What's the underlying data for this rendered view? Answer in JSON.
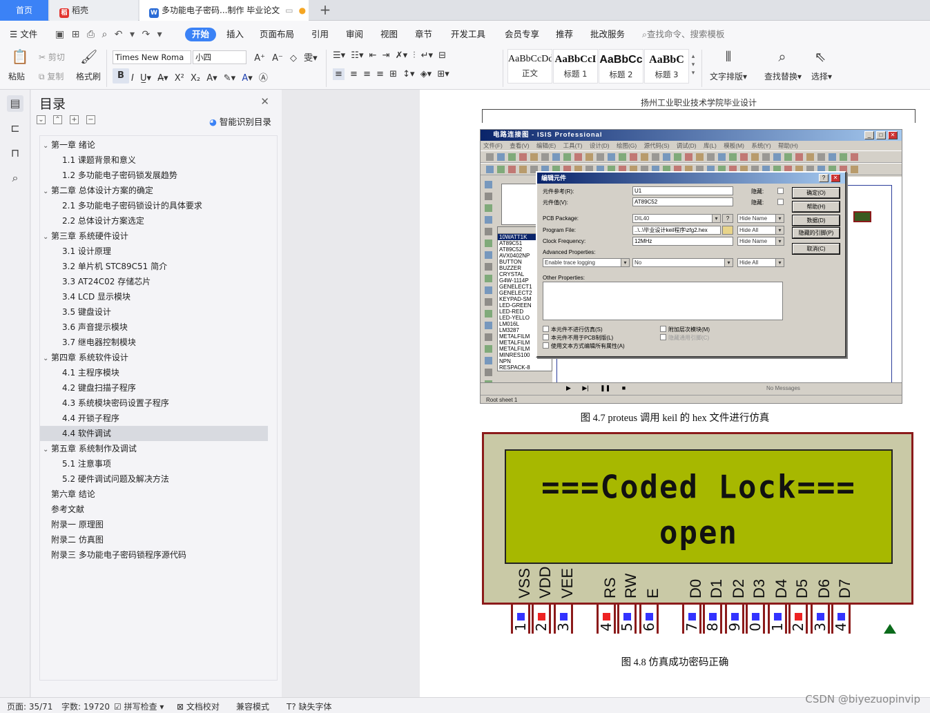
{
  "tabs": {
    "home": "首页",
    "daoke": "稻壳",
    "doc": "多功能电子密码...制作 毕业论文",
    "add": "+"
  },
  "menu": {
    "file": "文件",
    "items": [
      "开始",
      "插入",
      "页面布局",
      "引用",
      "审阅",
      "视图",
      "章节",
      "开发工具",
      "会员专享",
      "推荐",
      "批改服务"
    ],
    "search": "查找命令、搜索模板"
  },
  "ribbon": {
    "paste": "粘贴",
    "cut": "剪切",
    "copy": "复制",
    "format_painter": "格式刷",
    "font_name": "Times New Roma",
    "font_size": "小四",
    "styles": [
      {
        "preview": "AaBbCcDd",
        "label": "正文"
      },
      {
        "preview": "AaBbCcI",
        "label": "标题 1"
      },
      {
        "preview": "AaBbCc",
        "label": "标题 2"
      },
      {
        "preview": "AaBbC",
        "label": "标题 3"
      }
    ],
    "text_layout": "文字排版",
    "find_replace": "查找替换",
    "select": "选择"
  },
  "toc": {
    "title": "目录",
    "smart": "智能识别目录",
    "items": [
      {
        "text": "第一章  绪论",
        "level": 1
      },
      {
        "text": "1.1  课题背景和意义",
        "level": 2
      },
      {
        "text": "1.2  多功能电子密码锁发展趋势",
        "level": 2
      },
      {
        "text": "第二章  总体设计方案的确定",
        "level": 1
      },
      {
        "text": "2.1  多功能电子密码锁设计的具体要求",
        "level": 2
      },
      {
        "text": "2.2  总体设计方案选定",
        "level": 2
      },
      {
        "text": "第三章  系统硬件设计",
        "level": 1
      },
      {
        "text": "3.1    设计原理",
        "level": 2
      },
      {
        "text": "3.2    单片机 STC89C51 简介",
        "level": 2
      },
      {
        "text": "3.3    AT24C02 存储芯片",
        "level": 2
      },
      {
        "text": "3.4    LCD 显示模块",
        "level": 2
      },
      {
        "text": "3.5    键盘设计",
        "level": 2
      },
      {
        "text": "3.6    声音提示模块",
        "level": 2
      },
      {
        "text": "3.7  继电器控制模块",
        "level": 2
      },
      {
        "text": "第四章  系统软件设计",
        "level": 1
      },
      {
        "text": "4.1 主程序模块",
        "level": 2
      },
      {
        "text": "4.2  键盘扫描子程序",
        "level": 2
      },
      {
        "text": "4.3  系统模块密码设置子程序",
        "level": 2
      },
      {
        "text": "4.4 开锁子程序",
        "level": 2
      },
      {
        "text": "4.4 软件调试",
        "level": 2,
        "selected": true
      },
      {
        "text": "第五章  系统制作及调试",
        "level": 1
      },
      {
        "text": "5.1  注意事项",
        "level": 2
      },
      {
        "text": "5.2  硬件调试问题及解决方法",
        "level": 2
      },
      {
        "text": "第六章  结论",
        "level": 0
      },
      {
        "text": "参考文献",
        "level": 0
      },
      {
        "text": "附录一  原理图",
        "level": 0
      },
      {
        "text": "附录二  仿真图",
        "level": 0
      },
      {
        "text": "附录三  多功能电子密码锁程序源代码",
        "level": 0
      }
    ]
  },
  "page": {
    "header": "扬州工业职业技术学院毕业设计",
    "caption1": "图 4.7    proteus 调用 keil 的 hex 文件进行仿真",
    "caption2": "图 4.8    仿真成功密码正确"
  },
  "isis": {
    "title": "电路连接图 - ISIS Professional",
    "menu": "文件(F) 查看(V) 编辑(E) 工具(T) 设计(D) 绘图(G) 源代码(S) 调试(D) 库(L) 模板(M) 系统(Y) 帮助(H)",
    "devices": [
      "10WATT1K",
      "AT89C51",
      "AT89C52",
      "AVX0402NP",
      "BUTTON",
      "BUZZER",
      "CRYSTAL",
      "G4W-1114P",
      "GENELECT1",
      "GENELECT2",
      "KEYPAD-SM",
      "LED-GREEN",
      "LED-RED",
      "LED-YELLO",
      "LM016L",
      "LM3287",
      "METALFILM",
      "METALFILM",
      "METALFILM",
      "MINRES100",
      "NPN",
      "RESPACK-8"
    ],
    "status_left": "Root sheet 1",
    "status_msg": "No Messages",
    "dialog": {
      "title": "编辑元件",
      "ref_label": "元件参考(R):",
      "ref_value": "U1",
      "val_label": "元件值(V):",
      "val_value": "AT89C52",
      "hidden": "隐藏:",
      "pcb_label": "PCB Package:",
      "pcb_value": "DIL40",
      "prog_label": "Program File:",
      "prog_value": "..\\..\\毕业设计keil程序\\zfg2.hex",
      "clock_label": "Clock Frequency:",
      "clock_value": "12MHz",
      "adv_label": "Advanced Properties:",
      "adv_value": "Enable trace logging",
      "adv_opt": "No",
      "hide_name": "Hide Name",
      "hide_all": "Hide All",
      "other_label": "Other Properties:",
      "chk1": "本元件不进行仿真(S)",
      "chk2": "本元件不用于PCB制版(L)",
      "chk3": "使用文本方式编辑所有属性(A)",
      "chk4": "附加层次模块(M)",
      "chk5": "隐藏通用引脚(C)",
      "btn_ok": "确定(O)",
      "btn_help": "帮助(H)",
      "btn_data": "数据(D)",
      "btn_hidden": "隐藏的引脚(P)",
      "btn_cancel": "取消(C)",
      "q": "?"
    }
  },
  "lcd": {
    "line1": "===Coded Lock===",
    "line2": "open",
    "pins": [
      "VSS",
      "VDD",
      "VEE",
      "RS",
      "RW",
      "E",
      "D0",
      "D1",
      "D2",
      "D3",
      "D4",
      "D5",
      "D6",
      "D7"
    ],
    "pin_numbers": [
      "1",
      "2",
      "3",
      "4",
      "5",
      "6",
      "7",
      "8",
      "9",
      "0",
      "1",
      "2",
      "3",
      "4"
    ],
    "pin_colors": [
      "#3333ff",
      "#ee2222",
      "#3333ff",
      "#ee2222",
      "#3333ff",
      "#3333ff",
      "#3333ff",
      "#3333ff",
      "#3333ff",
      "#3333ff",
      "#3333ff",
      "#ee2222",
      "#3333ff",
      "#3333ff"
    ]
  },
  "status": {
    "page": "页面: 35/71",
    "words": "字数: 19720",
    "spell": "拼写检查",
    "proof": "文档校对",
    "compat": "兼容模式",
    "missing_font": "缺失字体"
  },
  "watermark": "CSDN @biyezuopinvip",
  "colors": {
    "accent": "#3b82f6",
    "lcd": "#a7b800",
    "lcd_frame": "#8b1a1a"
  }
}
